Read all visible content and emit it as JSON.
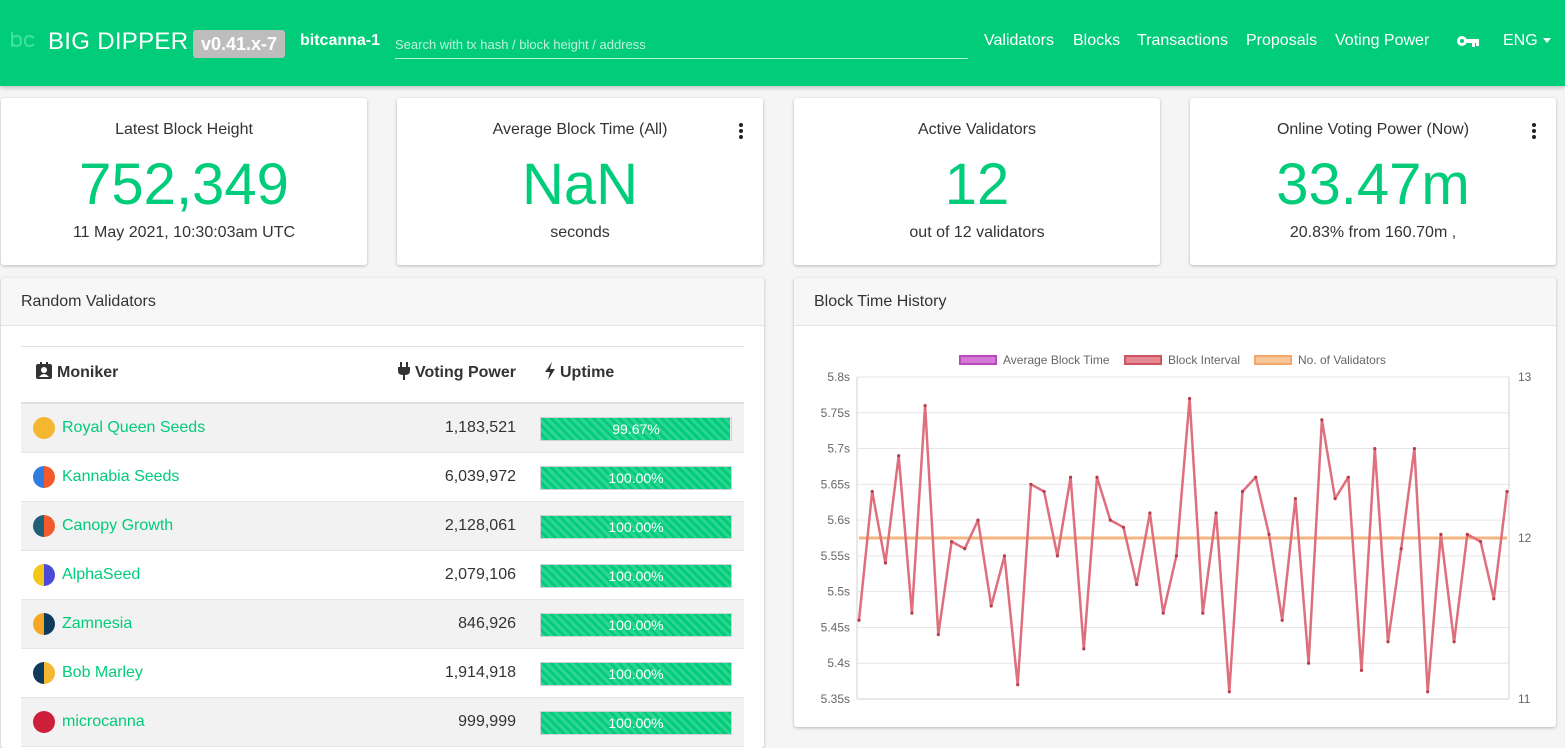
{
  "header": {
    "brand": "BIG DIPPER",
    "version": "v0.41.x-7",
    "chain_id": "bitcanna-1",
    "search_placeholder": "Search with tx hash / block height / address",
    "nav": [
      "Validators",
      "Blocks",
      "Transactions",
      "Proposals",
      "Voting Power"
    ],
    "language": "ENG",
    "icons": [
      "bc-logo-icon",
      "key-icon",
      "caret-down-icon"
    ]
  },
  "stats": {
    "latest_block": {
      "title": "Latest Block Height",
      "value": "752,349",
      "sub": "11 May 2021, 10:30:03am UTC"
    },
    "avg_block_time": {
      "title": "Average Block Time (All)",
      "value": "NaN",
      "sub": "seconds"
    },
    "active_validators": {
      "title": "Active Validators",
      "value": "12",
      "sub": "out of 12 validators"
    },
    "voting_power": {
      "title": "Online Voting Power (Now)",
      "value": "33.47m",
      "sub": "20.83% from 160.70m ,"
    }
  },
  "colors": {
    "accent": "#00cc7a",
    "block_interval": "#de6f7d",
    "avg_block_time": "#cc65cc",
    "validators": "#f6b27a"
  },
  "validators_panel": {
    "title": "Random Validators",
    "columns": {
      "moniker": "Moniker",
      "voting_power": "Voting Power",
      "uptime": "Uptime"
    },
    "rows": [
      {
        "name": "Royal Queen Seeds",
        "voting_power": "1,183,521",
        "uptime": "99.67%",
        "uptime_value": 99.67
      },
      {
        "name": "Kannabia Seeds",
        "voting_power": "6,039,972",
        "uptime": "100.00%",
        "uptime_value": 100
      },
      {
        "name": "Canopy Growth",
        "voting_power": "2,128,061",
        "uptime": "100.00%",
        "uptime_value": 100
      },
      {
        "name": "AlphaSeed",
        "voting_power": "2,079,106",
        "uptime": "100.00%",
        "uptime_value": 100
      },
      {
        "name": "Zamnesia",
        "voting_power": "846,926",
        "uptime": "100.00%",
        "uptime_value": 100
      },
      {
        "name": "Bob Marley",
        "voting_power": "1,914,918",
        "uptime": "100.00%",
        "uptime_value": 100
      },
      {
        "name": "microcanna",
        "voting_power": "999,999",
        "uptime": "100.00%",
        "uptime_value": 100
      }
    ]
  },
  "chart_panel": {
    "title": "Block Time History"
  },
  "chart_data": {
    "type": "line",
    "legend": [
      "Average Block Time",
      "Block Interval",
      "No. of Validators"
    ],
    "legend_position": "top",
    "grid": true,
    "y_left": {
      "ticks": [
        "5.8s",
        "5.75s",
        "5.7s",
        "5.65s",
        "5.6s",
        "5.55s",
        "5.5s",
        "5.45s",
        "5.4s",
        "5.35s"
      ],
      "range": [
        5.35,
        5.8
      ]
    },
    "y_right": {
      "ticks": [
        "13",
        "12",
        "11"
      ],
      "range": [
        11,
        13
      ]
    },
    "series": [
      {
        "name": "Block Interval",
        "values": [
          5.46,
          5.64,
          5.54,
          5.69,
          5.47,
          5.76,
          5.44,
          5.57,
          5.56,
          5.6,
          5.48,
          5.55,
          5.37,
          5.65,
          5.64,
          5.55,
          5.66,
          5.42,
          5.66,
          5.6,
          5.59,
          5.51,
          5.61,
          5.47,
          5.55,
          5.77,
          5.47,
          5.61,
          5.36,
          5.64,
          5.66,
          5.58,
          5.46,
          5.63,
          5.4,
          5.74,
          5.63,
          5.66,
          5.39,
          5.7,
          5.43,
          5.56,
          5.7,
          5.36,
          5.58,
          5.43,
          5.58,
          5.57,
          5.49,
          5.64
        ]
      },
      {
        "name": "No. of Validators",
        "values": [
          12,
          12,
          12,
          12,
          12,
          12,
          12,
          12,
          12,
          12,
          12,
          12,
          12,
          12,
          12,
          12,
          12,
          12,
          12,
          12,
          12,
          12,
          12,
          12,
          12,
          12,
          12,
          12,
          12,
          12,
          12,
          12,
          12,
          12,
          12,
          12,
          12,
          12,
          12,
          12,
          12,
          12,
          12,
          12,
          12,
          12,
          12,
          12,
          12,
          12
        ]
      }
    ]
  }
}
